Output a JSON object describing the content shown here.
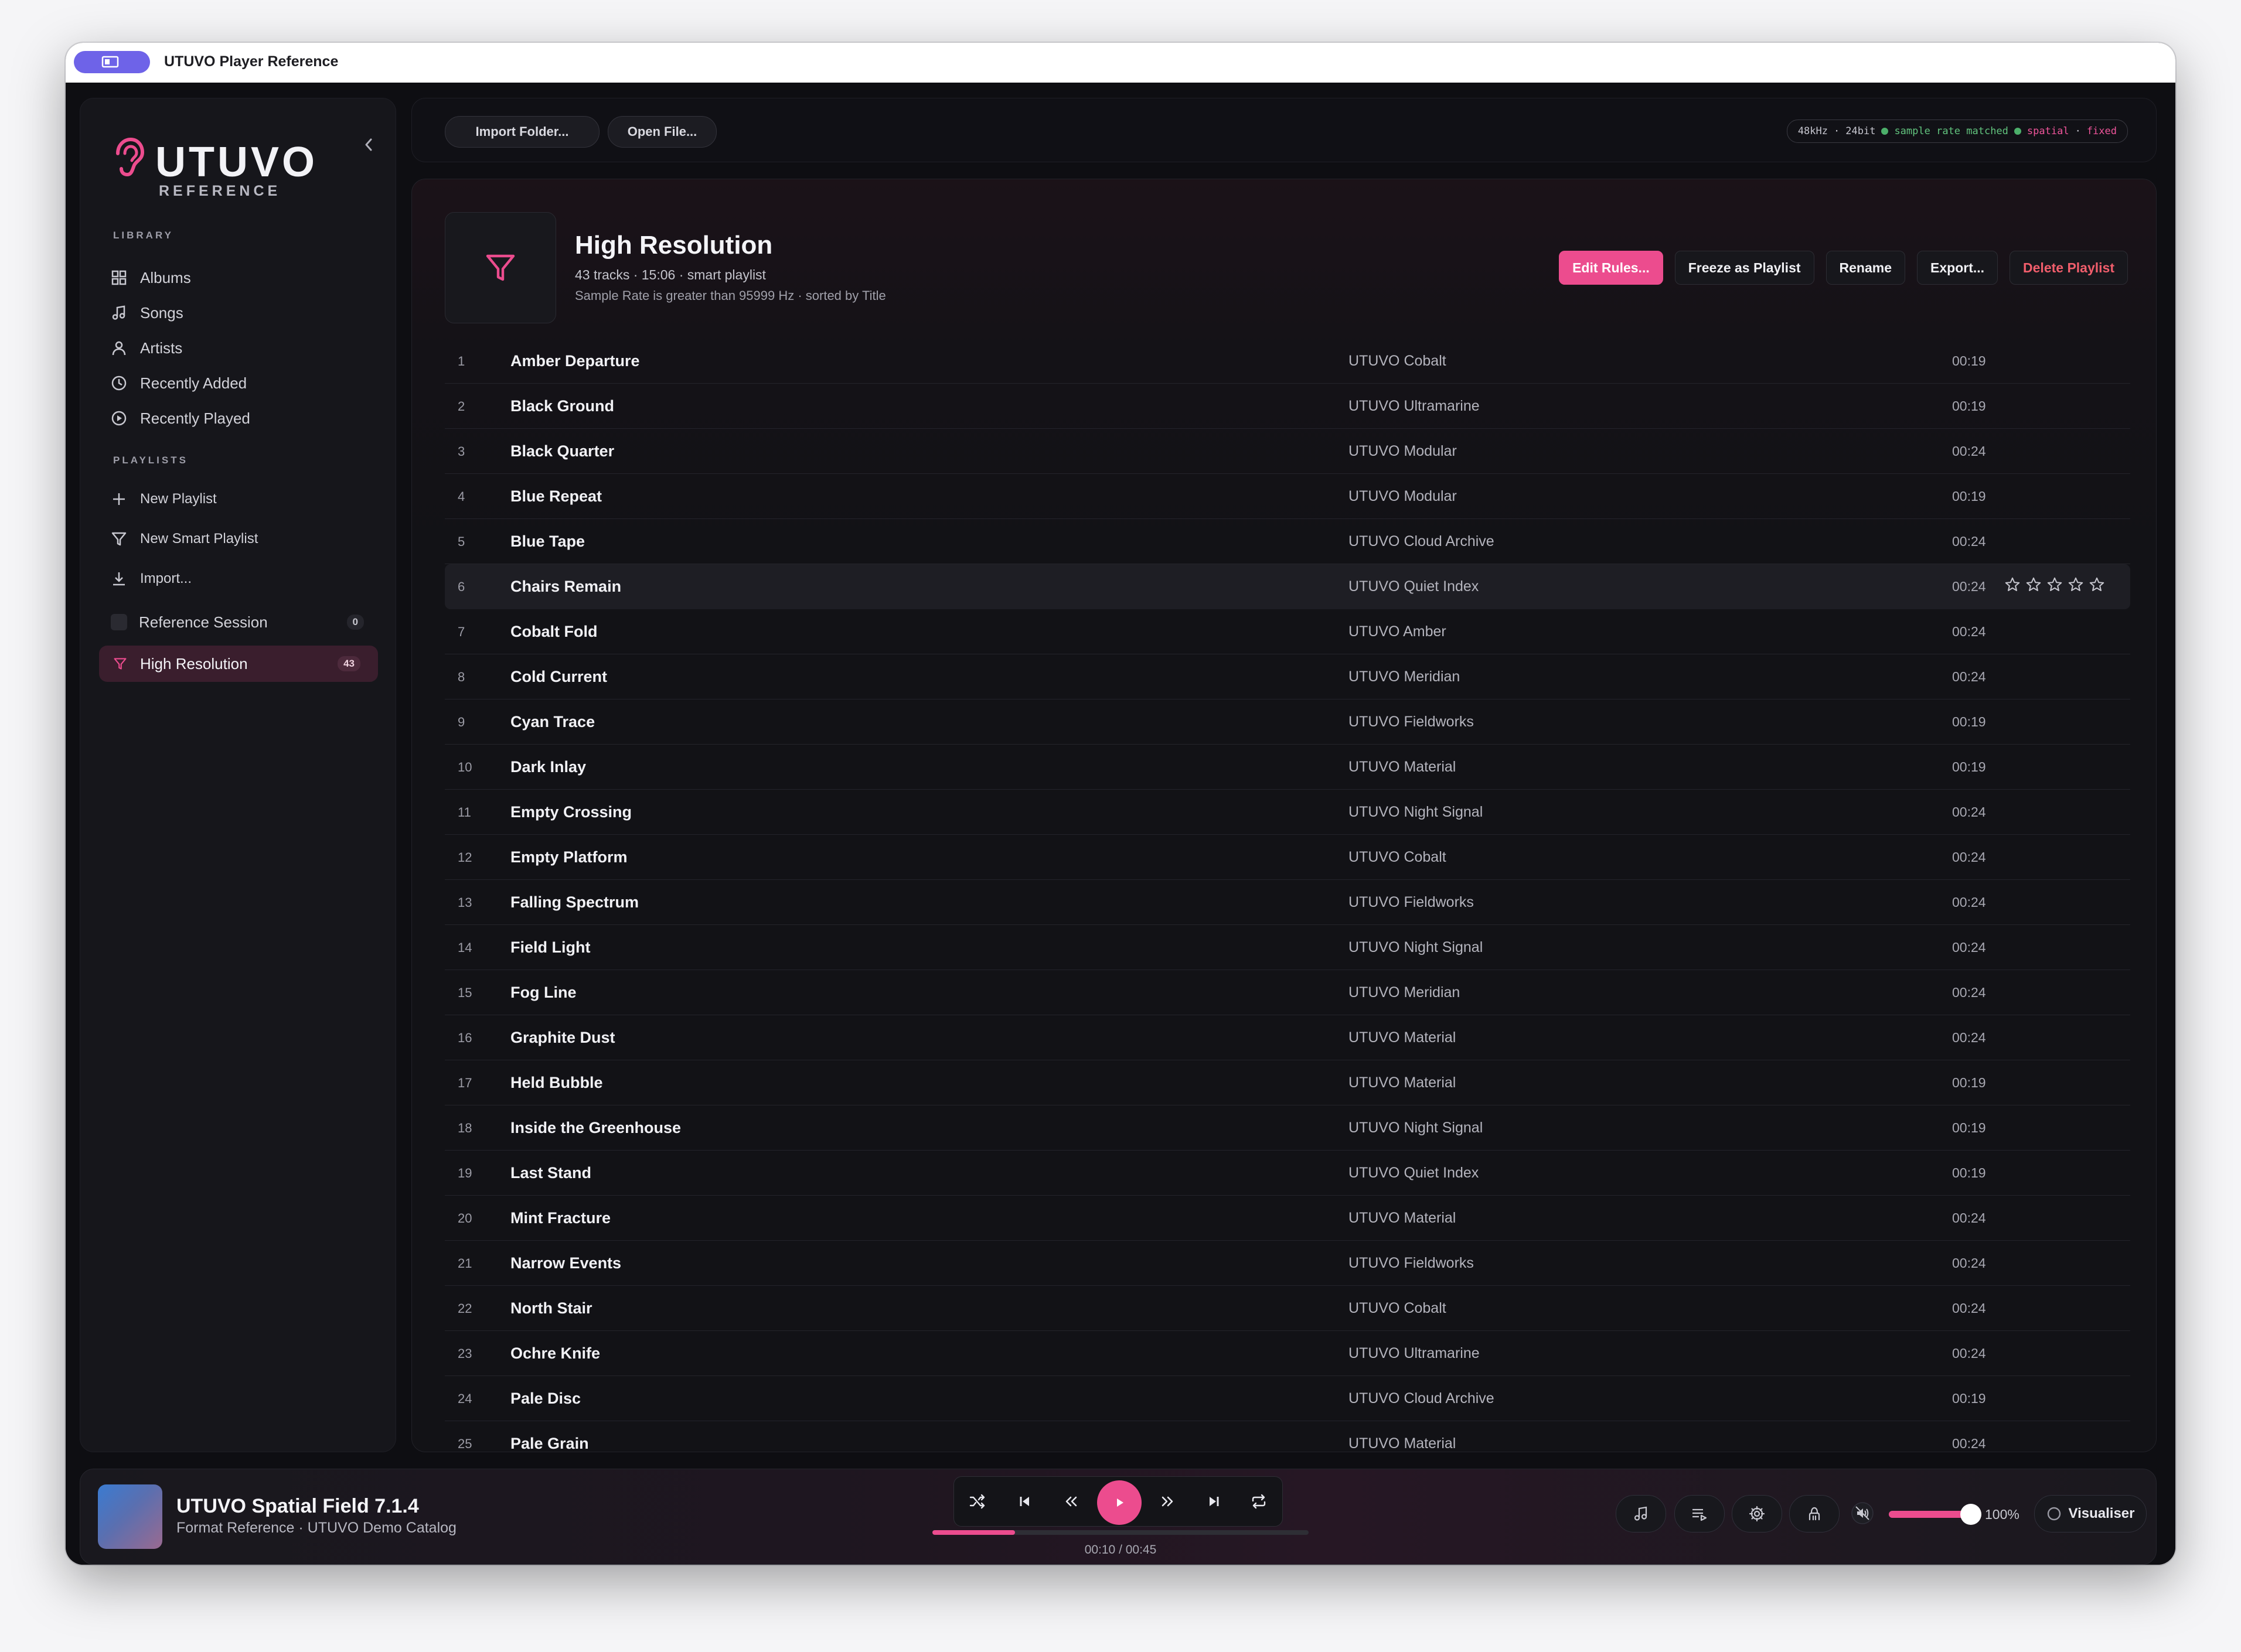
{
  "window": {
    "title": "UTUVO Player Reference"
  },
  "brand": {
    "name": "UTUVO",
    "subtitle": "REFERENCE",
    "accent": "#ec4c8e"
  },
  "sidebar": {
    "library_label": "LIBRARY",
    "library": [
      {
        "label": "Albums",
        "icon": "grid-icon"
      },
      {
        "label": "Songs",
        "icon": "music-note-icon"
      },
      {
        "label": "Artists",
        "icon": "person-icon"
      },
      {
        "label": "Recently Added",
        "icon": "clock-icon"
      },
      {
        "label": "Recently Played",
        "icon": "play-circle-icon"
      }
    ],
    "playlists_label": "PLAYLISTS",
    "playlist_actions": [
      {
        "label": "New Playlist",
        "icon": "plus-icon"
      },
      {
        "label": "New Smart Playlist",
        "icon": "filter-icon"
      },
      {
        "label": "Import...",
        "icon": "download-icon"
      }
    ],
    "playlists": [
      {
        "label": "Reference Session",
        "count": "0"
      },
      {
        "label": "High Resolution",
        "count": "43",
        "active": true
      }
    ]
  },
  "toolbar": {
    "import_folder": "Import Folder...",
    "open_file": "Open File...",
    "status": {
      "rate": "48kHz",
      "sep": "·",
      "depth": "24bit",
      "matched": "sample rate matched",
      "spatial": "spatial",
      "fixed": "fixed"
    }
  },
  "playlist": {
    "title": "High Resolution",
    "meta": "43 tracks · 15:06 · smart playlist",
    "rule": "Sample Rate is greater than 95999 Hz · sorted by Title",
    "actions": {
      "edit": "Edit Rules...",
      "freeze": "Freeze as Playlist",
      "rename": "Rename",
      "export": "Export...",
      "delete": "Delete Playlist"
    },
    "tracks": [
      {
        "n": "1",
        "title": "Amber Departure",
        "album": "UTUVO Cobalt",
        "dur": "00:19"
      },
      {
        "n": "2",
        "title": "Black Ground",
        "album": "UTUVO Ultramarine",
        "dur": "00:19"
      },
      {
        "n": "3",
        "title": "Black Quarter",
        "album": "UTUVO Modular",
        "dur": "00:24"
      },
      {
        "n": "4",
        "title": "Blue Repeat",
        "album": "UTUVO Modular",
        "dur": "00:19"
      },
      {
        "n": "5",
        "title": "Blue Tape",
        "album": "UTUVO Cloud Archive",
        "dur": "00:24"
      },
      {
        "n": "6",
        "title": "Chairs Remain",
        "album": "UTUVO Quiet Index",
        "dur": "00:24",
        "hover": true
      },
      {
        "n": "7",
        "title": "Cobalt Fold",
        "album": "UTUVO Amber",
        "dur": "00:24"
      },
      {
        "n": "8",
        "title": "Cold Current",
        "album": "UTUVO Meridian",
        "dur": "00:24"
      },
      {
        "n": "9",
        "title": "Cyan Trace",
        "album": "UTUVO Fieldworks",
        "dur": "00:19"
      },
      {
        "n": "10",
        "title": "Dark Inlay",
        "album": "UTUVO Material",
        "dur": "00:19"
      },
      {
        "n": "11",
        "title": "Empty Crossing",
        "album": "UTUVO Night Signal",
        "dur": "00:24"
      },
      {
        "n": "12",
        "title": "Empty Platform",
        "album": "UTUVO Cobalt",
        "dur": "00:24"
      },
      {
        "n": "13",
        "title": "Falling Spectrum",
        "album": "UTUVO Fieldworks",
        "dur": "00:24"
      },
      {
        "n": "14",
        "title": "Field Light",
        "album": "UTUVO Night Signal",
        "dur": "00:24"
      },
      {
        "n": "15",
        "title": "Fog Line",
        "album": "UTUVO Meridian",
        "dur": "00:24"
      },
      {
        "n": "16",
        "title": "Graphite Dust",
        "album": "UTUVO Material",
        "dur": "00:24"
      },
      {
        "n": "17",
        "title": "Held Bubble",
        "album": "UTUVO Material",
        "dur": "00:19"
      },
      {
        "n": "18",
        "title": "Inside the Greenhouse",
        "album": "UTUVO Night Signal",
        "dur": "00:19"
      },
      {
        "n": "19",
        "title": "Last Stand",
        "album": "UTUVO Quiet Index",
        "dur": "00:19"
      },
      {
        "n": "20",
        "title": "Mint Fracture",
        "album": "UTUVO Material",
        "dur": "00:24"
      },
      {
        "n": "21",
        "title": "Narrow Events",
        "album": "UTUVO Fieldworks",
        "dur": "00:24"
      },
      {
        "n": "22",
        "title": "North Stair",
        "album": "UTUVO Cobalt",
        "dur": "00:24"
      },
      {
        "n": "23",
        "title": "Ochre Knife",
        "album": "UTUVO Ultramarine",
        "dur": "00:24"
      },
      {
        "n": "24",
        "title": "Pale Disc",
        "album": "UTUVO Cloud Archive",
        "dur": "00:19"
      },
      {
        "n": "25",
        "title": "Pale Grain",
        "album": "UTUVO Material",
        "dur": "00:24"
      }
    ]
  },
  "player": {
    "title": "UTUVO Spatial Field 7.1.4",
    "subtitle": "Format Reference · UTUVO Demo Catalog",
    "time": "00:10 / 00:45",
    "progress": 0.22,
    "volume": 1.0,
    "volume_label": "100%",
    "visualiser": "Visualiser"
  }
}
